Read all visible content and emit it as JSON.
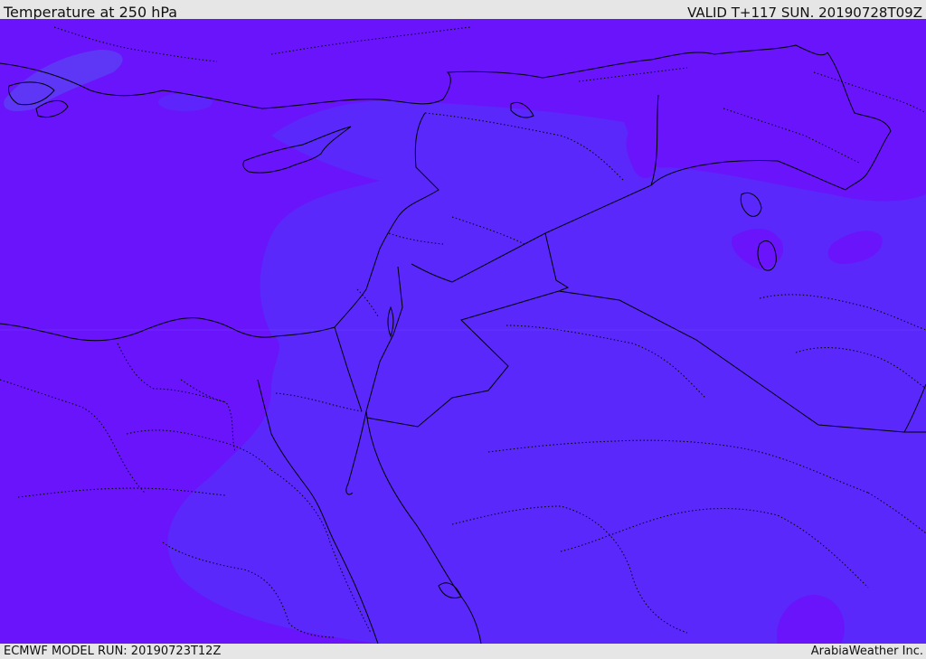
{
  "header": {
    "title": "Temperature at 250 hPa",
    "valid": "VALID T+117 SUN. 20190728T09Z"
  },
  "footer": {
    "model_run": "ECMWF MODEL RUN: 20190723T12Z",
    "credit": "ArabiaWeather Inc."
  },
  "map": {
    "parameter": "Temperature",
    "level": "250 hPa",
    "region": "Eastern Mediterranean and Middle East",
    "colors": {
      "cold_shade": "#6a14fb",
      "warm_shade": "#5a28fa",
      "light_patch": "#5b3ef5",
      "boundary": "#000000"
    }
  }
}
